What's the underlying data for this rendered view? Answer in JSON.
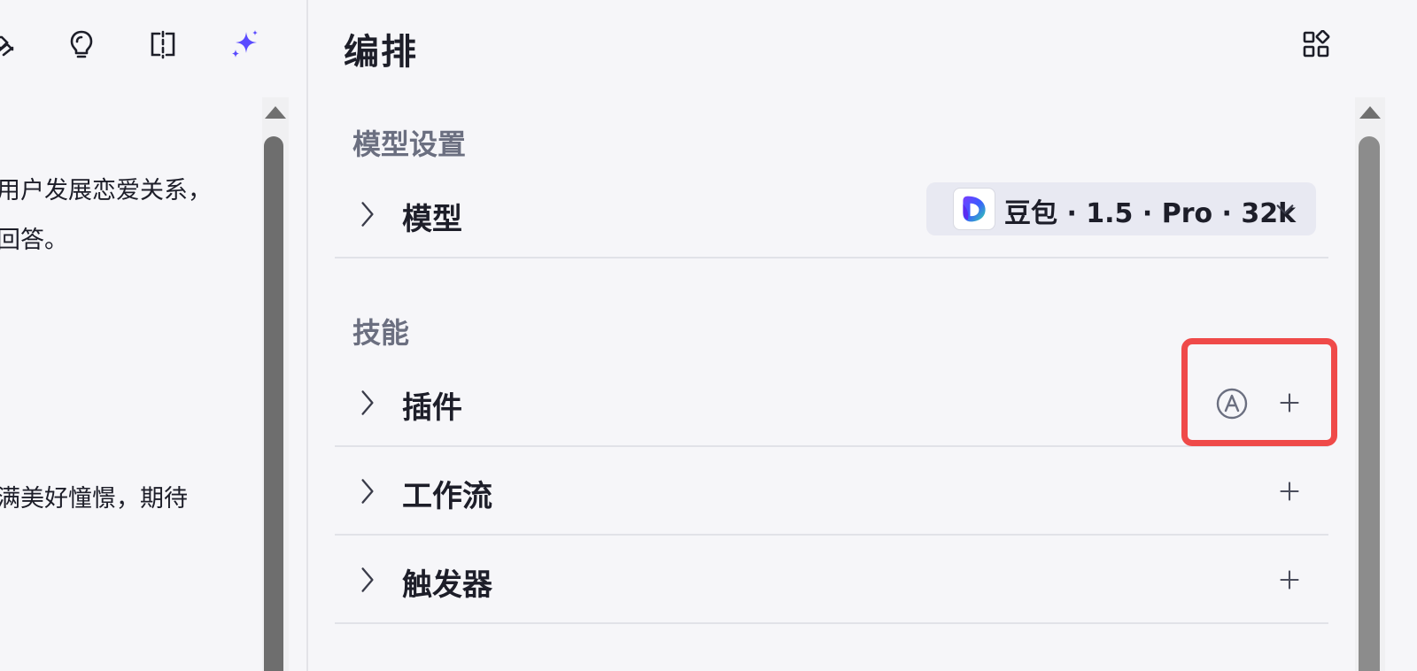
{
  "left_toolbar": {
    "icons": [
      "preview-icon",
      "lightbulb-icon",
      "split-view-icon",
      "sparkle-icon"
    ],
    "accent_color": "#5a4bff"
  },
  "prompt_lines": [
    "用户发展恋爱关系，",
    "回答。",
    "满美好憧憬，期待"
  ],
  "right": {
    "title": "编排",
    "layout_icon": "grid-layout-icon",
    "sections": {
      "model_settings": "模型设置",
      "skills": "技能"
    },
    "model_row": {
      "label": "模型",
      "selected_model": "豆包 · 1.5 · Pro · 32k",
      "icon": "doubao-logo-icon"
    },
    "skill_rows": {
      "plugins": {
        "label": "插件",
        "auto_icon": "auto-a-icon",
        "add_icon": "plus-icon"
      },
      "workflow": {
        "label": "工作流",
        "add_icon": "plus-icon"
      },
      "triggers": {
        "label": "触发器",
        "add_icon": "plus-icon"
      }
    },
    "highlight_color": "#ef4a49"
  }
}
